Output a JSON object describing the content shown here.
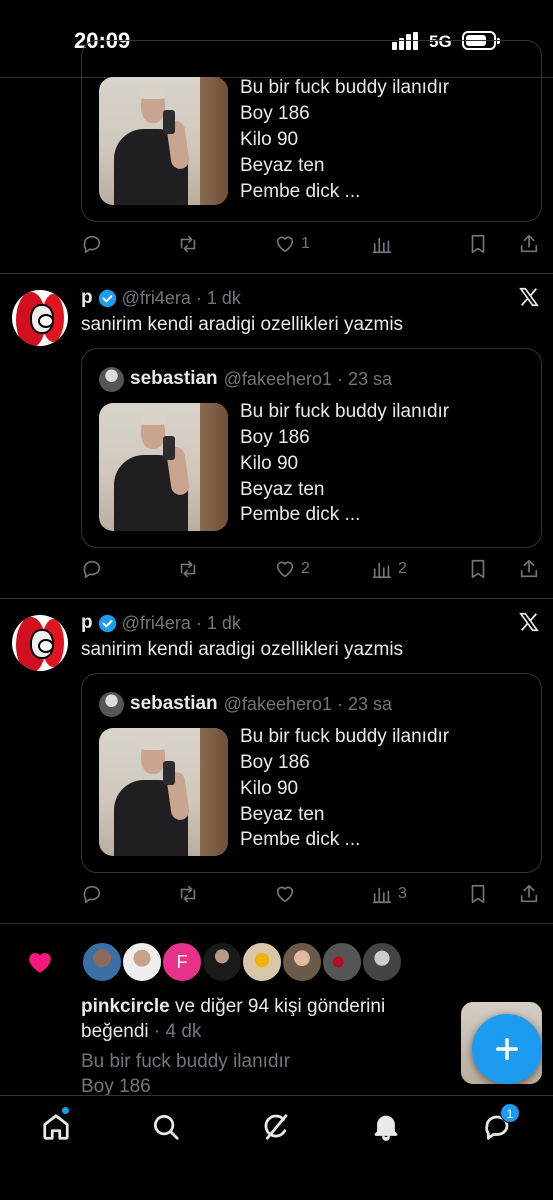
{
  "status_bar": {
    "time": "20:09",
    "network": "5G"
  },
  "quote_text_lines": [
    "Bu bir fuck buddy ilanıdır",
    "Boy 186",
    "Kilo 90",
    "Beyaz ten",
    "Pembe dick ..."
  ],
  "top_post": {
    "actions": {
      "like_count": "1"
    }
  },
  "posts": [
    {
      "name": "p",
      "handle_time": "@fri4era · 1 dk",
      "text": "sanirim kendi aradigi ozellikleri yazmis",
      "quote": {
        "name": "sebastian",
        "handle_time": "@fakeehero1 · 23 sa"
      },
      "actions": {
        "like_count": "2",
        "view_count": "2"
      }
    },
    {
      "name": "p",
      "handle_time": "@fri4era · 1 dk",
      "text": "sanirim kendi aradigi ozellikleri yazmis",
      "quote": {
        "name": "sebastian",
        "handle_time": "@fakeehero1 · 23 sa"
      },
      "actions": {
        "like_count": "",
        "view_count": "3"
      }
    }
  ],
  "notification": {
    "user": "pinkcircle",
    "text_1": " ve diğer 94 kişi gönderini",
    "text_2": "beğendi",
    "time": " · 4 dk",
    "avatar_letter": "F",
    "preview_lines": [
      "Bu bir fuck buddy ilanıdır",
      "Boy 186"
    ]
  },
  "nav": {
    "messages_badge": "1"
  },
  "colors": {
    "accent": "#1d9bf0",
    "like_pink": "#f91880",
    "muted": "#71767b",
    "divider": "#2f3336"
  }
}
